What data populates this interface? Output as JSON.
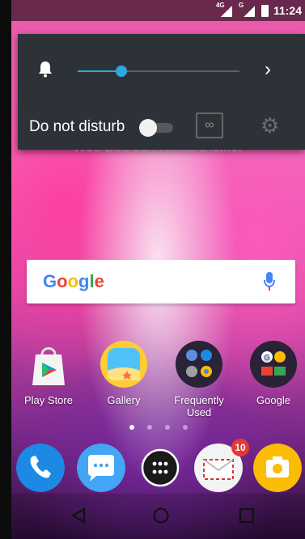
{
  "status_bar": {
    "sim1_label": "4G",
    "sim2_label": "G",
    "time": "11:24"
  },
  "quick_panel": {
    "volume_level": 0.27,
    "dnd_label": "Do not disturb",
    "infinity_symbol": "∞",
    "accent_color": "#2fa8e0"
  },
  "wallpaper_text": "Wed Dec 09 / Neihu District",
  "search": {
    "logo": "Google"
  },
  "apps": [
    {
      "label": "Play Store"
    },
    {
      "label": "Gallery"
    },
    {
      "label": "Frequently Used"
    },
    {
      "label": "Google"
    }
  ],
  "dock": {
    "email_badge": "10"
  },
  "icons": {
    "bell": "bell-icon",
    "chevron": "chevron-right-icon",
    "gear": "gear-icon",
    "mic": "mic-icon"
  }
}
